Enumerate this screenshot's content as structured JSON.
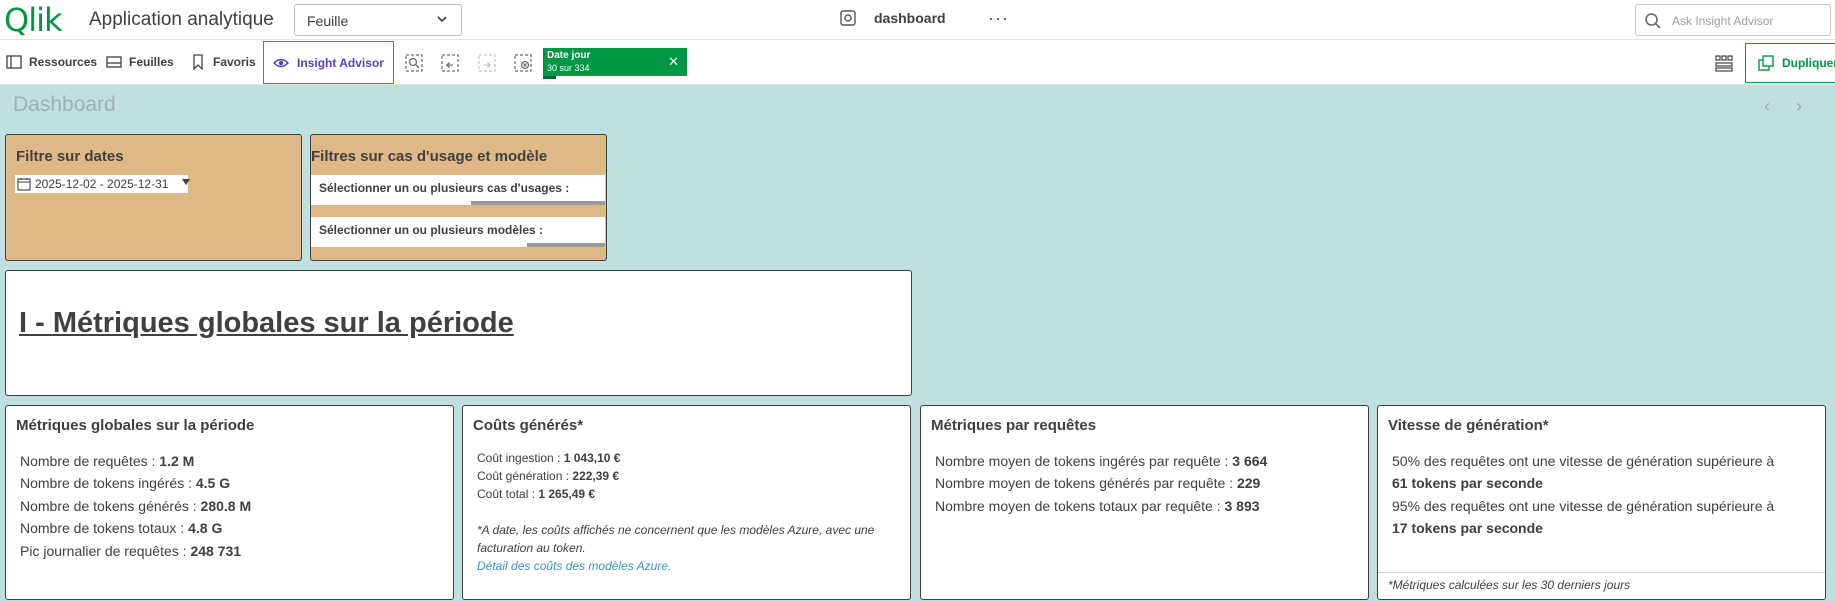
{
  "header": {
    "logo_text": "Qlik",
    "app_title": "Application analytique",
    "sheet_dropdown": "Feuille",
    "current_sheet": "dashboard",
    "more": "···",
    "search_placeholder": "Ask Insight Advisor"
  },
  "toolbar": {
    "resources": "Ressources",
    "sheets": "Feuilles",
    "favorites": "Favoris",
    "insight": "Insight Advisor",
    "selection_chip": {
      "field": "Date jour",
      "count": "30 sur 334"
    },
    "duplicate": "Dupliquer"
  },
  "sheet": {
    "title": "Dashboard"
  },
  "filters": {
    "date_title": "Filtre sur dates",
    "date_range": "2025-12-02 - 2025-12-31",
    "usecase_title": "Filtres sur cas d'usage et modèle",
    "usecase_select": "Sélectionner un ou plusieurs cas d'usages :",
    "model_select": "Sélectionner un ou plusieurs modèles :"
  },
  "section": {
    "heading": "I - Métriques globales sur la période"
  },
  "global": {
    "title": "Métriques globales sur la période",
    "rows": [
      {
        "label": "Nombre de requêtes : ",
        "value": "1.2 M"
      },
      {
        "label": "Nombre de tokens ingérés : ",
        "value": "4.5 G"
      },
      {
        "label": "Nombre de tokens générés : ",
        "value": "280.8 M"
      },
      {
        "label": "Nombre de tokens totaux : ",
        "value": "4.8 G"
      },
      {
        "label": "Pic journalier de requêtes : ",
        "value": "248 731"
      }
    ]
  },
  "costs": {
    "title": "Coûts générés*",
    "rows": [
      {
        "label": "Coût ingestion : ",
        "value": "1 043,10 €"
      },
      {
        "label": "Coût génération : ",
        "value": "222,39 €"
      },
      {
        "label": "Coût total : ",
        "value": "1 265,49 €"
      }
    ],
    "note_line1": "*A date, les coûts affichés ne concernent que les modèles Azure, avec une",
    "note_line2": "facturation au token.",
    "link": "Détail des coûts des modèles Azure."
  },
  "per_request": {
    "title": "Métriques par requêtes",
    "rows": [
      {
        "label": "Nombre moyen de tokens ingérés par requête : ",
        "value": "3 664"
      },
      {
        "label": "Nombre moyen de tokens générés par requête : ",
        "value": "229"
      },
      {
        "label": "Nombre moyen de tokens totaux par requête : ",
        "value": "3 893"
      }
    ]
  },
  "speed": {
    "title": "Vitesse de génération*",
    "line1": "50% des requêtes ont une vitesse de génération supérieure à",
    "line1_value": "61 tokens par seconde",
    "line2": "95% des requêtes ont une vitesse de génération supérieure à",
    "line2_value": "17 tokens par seconde",
    "footer": "*Métriques calculées sur les 30 derniers jours"
  }
}
